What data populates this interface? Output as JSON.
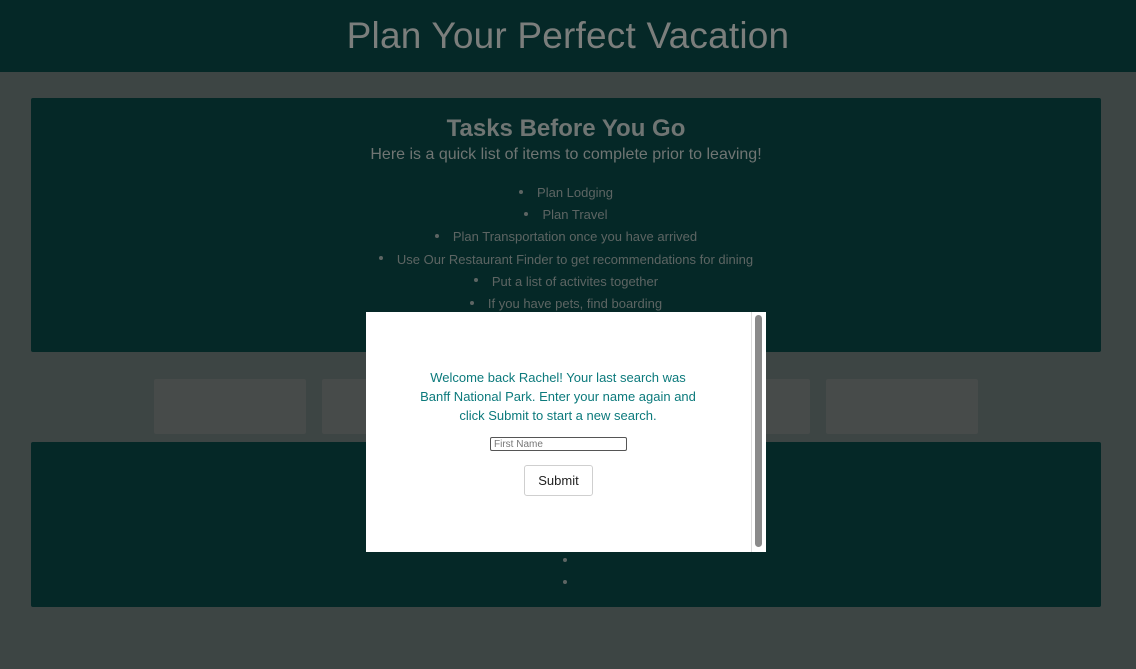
{
  "header": {
    "title": "Plan Your Perfect Vacation"
  },
  "tasks": {
    "heading": "Tasks Before You Go",
    "subtitle": "Here is a quick list of items to complete prior to leaving!",
    "items": [
      "Plan Lodging",
      "Plan Travel",
      "Plan Transportation once you have arrived",
      "Use Our Restaurant Finder to get recommendations for dining",
      "Put a list of activites together",
      "If you have pets, find boarding"
    ]
  },
  "modal": {
    "message": "Welcome back Rachel! Your last search was Banff National Park. Enter your name again and click Submit to start a new search.",
    "input_placeholder": "First Name",
    "input_value": "",
    "submit_label": "Submit"
  },
  "colors": {
    "overlay_background": "#3d4544",
    "panel_background": "#052827",
    "modal_text": "#0c7a7c"
  }
}
